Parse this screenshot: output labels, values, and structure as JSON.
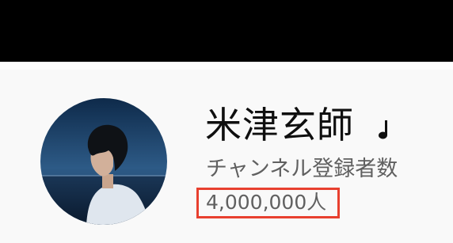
{
  "channel": {
    "name": "米津玄師",
    "badge_icon": "music-note-icon",
    "subscribers_label": "チャンネル登録者数",
    "subscribers_count": "4,000,000人"
  },
  "colors": {
    "top_bar": "#000000",
    "header_background": "#f9f9f9",
    "name_text": "#0f0f0f",
    "secondary_text": "#606060",
    "highlight": "#e8402f"
  }
}
